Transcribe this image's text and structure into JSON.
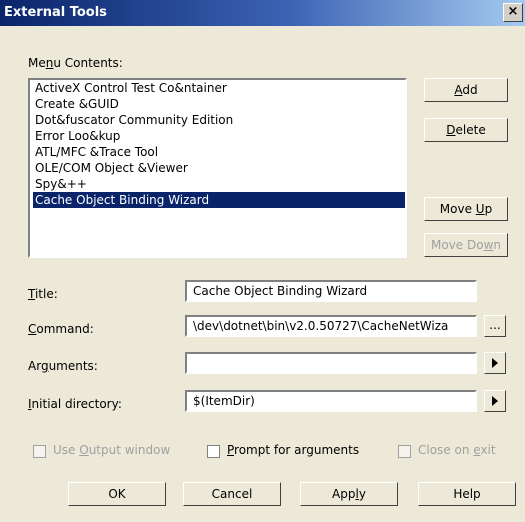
{
  "window": {
    "title": "External Tools",
    "close_glyph": "×"
  },
  "menu_contents": {
    "label_pre": "Me",
    "label_u": "n",
    "label_post": "u Contents:",
    "items": [
      "ActiveX Control Test Co&ntainer",
      "Create &GUID",
      "Dot&fuscator Community Edition",
      "Error Loo&kup",
      "ATL/MFC &Trace Tool",
      "OLE/COM Object &Viewer",
      "Spy&++",
      "Cache Object Binding Wizard"
    ],
    "selected": "Cache Object Binding Wizard"
  },
  "buttons": {
    "add": {
      "u": "A",
      "post": "dd"
    },
    "delete": {
      "u": "D",
      "post": "elete"
    },
    "move_up": {
      "pre": "Move ",
      "u": "U",
      "post": "p"
    },
    "move_down": {
      "pre": "Move Do",
      "u": "w",
      "post": "n"
    }
  },
  "fields": {
    "title": {
      "u": "T",
      "post": "itle:",
      "value": "Cache Object Binding Wizard"
    },
    "command": {
      "u": "C",
      "post": "ommand:",
      "value": "\\dev\\dotnet\\bin\\v2.0.50727\\CacheNetWiza"
    },
    "arguments": {
      "pre": "Ar",
      "u": "g",
      "post": "uments:",
      "value": ""
    },
    "initial_directory": {
      "u": "I",
      "post": "nitial directory:",
      "value": "$(ItemDir)"
    }
  },
  "browse_label": "...",
  "options": {
    "use_output": {
      "pre": "Use ",
      "u": "O",
      "post": "utput window",
      "checked": false,
      "enabled": false
    },
    "prompt_args": {
      "u": "P",
      "post": "rompt for arguments",
      "checked": false,
      "enabled": true
    },
    "close_on_exit": {
      "pre": "Close on ",
      "u": "e",
      "post": "xit",
      "checked": false,
      "enabled": false
    }
  },
  "footer": {
    "ok": "OK",
    "cancel": "Cancel",
    "apply": {
      "pre": "App",
      "u": "l",
      "post": "y"
    },
    "help": "Help"
  }
}
